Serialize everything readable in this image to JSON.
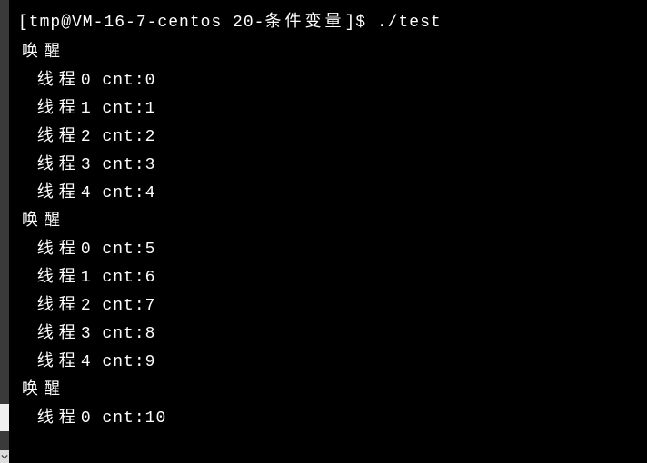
{
  "prompt": {
    "prefix": "[tmp@VM-16-7-centos 20-",
    "cjk": "条件变量",
    "suffix": "]$ ",
    "command": "./test"
  },
  "wake_label": "唤醒",
  "thread_label": "线程",
  "cnt_label": "cnt:",
  "blocks": [
    {
      "wake": true,
      "rows": [
        {
          "tid": "0",
          "cnt": "0"
        },
        {
          "tid": "1",
          "cnt": "1"
        },
        {
          "tid": "2",
          "cnt": "2"
        },
        {
          "tid": "3",
          "cnt": "3"
        },
        {
          "tid": "4",
          "cnt": "4"
        }
      ]
    },
    {
      "wake": true,
      "rows": [
        {
          "tid": "0",
          "cnt": "5"
        },
        {
          "tid": "1",
          "cnt": "6"
        },
        {
          "tid": "2",
          "cnt": "7"
        },
        {
          "tid": "3",
          "cnt": "8"
        },
        {
          "tid": "4",
          "cnt": "9"
        }
      ]
    },
    {
      "wake": true,
      "rows": [
        {
          "tid": "0",
          "cnt": "10"
        }
      ]
    }
  ]
}
